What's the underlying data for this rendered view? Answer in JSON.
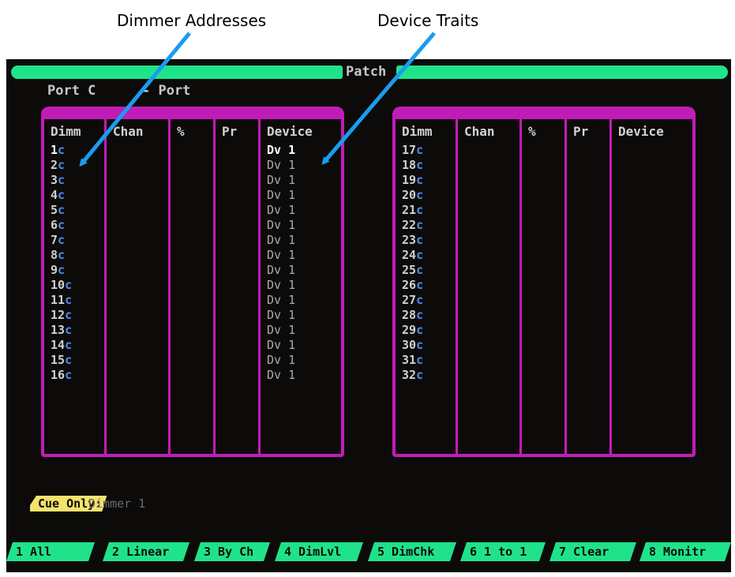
{
  "annotations": {
    "dimmer_addresses": "Dimmer Addresses",
    "device_traits": "Device Traits"
  },
  "screen": {
    "title": "Patch",
    "port_label": "Port C",
    "port_dash": "- Port",
    "columns": [
      "Dimm",
      "Chan",
      "%",
      "Pr",
      "Device"
    ],
    "left_panel": {
      "dimmers": [
        {
          "num": "1",
          "port": "c"
        },
        {
          "num": "2",
          "port": "c"
        },
        {
          "num": "3",
          "port": "c"
        },
        {
          "num": "4",
          "port": "c"
        },
        {
          "num": "5",
          "port": "c"
        },
        {
          "num": "6",
          "port": "c"
        },
        {
          "num": "7",
          "port": "c"
        },
        {
          "num": "8",
          "port": "c"
        },
        {
          "num": "9",
          "port": "c"
        },
        {
          "num": "10",
          "port": "c"
        },
        {
          "num": "11",
          "port": "c"
        },
        {
          "num": "12",
          "port": "c"
        },
        {
          "num": "13",
          "port": "c"
        },
        {
          "num": "14",
          "port": "c"
        },
        {
          "num": "15",
          "port": "c"
        },
        {
          "num": "16",
          "port": "c"
        }
      ],
      "devices": [
        "Dv 1",
        "Dv 1",
        "Dv 1",
        "Dv 1",
        "Dv 1",
        "Dv 1",
        "Dv 1",
        "Dv 1",
        "Dv 1",
        "Dv 1",
        "Dv 1",
        "Dv 1",
        "Dv 1",
        "Dv 1",
        "Dv 1",
        "Dv 1"
      ]
    },
    "right_panel": {
      "dimmers": [
        {
          "num": "17",
          "port": "c"
        },
        {
          "num": "18",
          "port": "c"
        },
        {
          "num": "19",
          "port": "c"
        },
        {
          "num": "20",
          "port": "c"
        },
        {
          "num": "21",
          "port": "c"
        },
        {
          "num": "22",
          "port": "c"
        },
        {
          "num": "23",
          "port": "c"
        },
        {
          "num": "24",
          "port": "c"
        },
        {
          "num": "25",
          "port": "c"
        },
        {
          "num": "26",
          "port": "c"
        },
        {
          "num": "27",
          "port": "c"
        },
        {
          "num": "28",
          "port": "c"
        },
        {
          "num": "29",
          "port": "c"
        },
        {
          "num": "30",
          "port": "c"
        },
        {
          "num": "31",
          "port": "c"
        },
        {
          "num": "32",
          "port": "c"
        }
      ]
    },
    "cue_label": "Cue Only:",
    "status": "Dimmer 1",
    "softkeys": [
      "1 All",
      "2 Linear",
      "3 By Ch",
      "4 DimLvl",
      "5 DimChk",
      "6 1 to 1",
      "7 Clear",
      "8 Monitr"
    ]
  },
  "colors": {
    "screen_bg": "#0d0b0a",
    "titlebar": "#1fe38a",
    "panel_border": "#c21cb8",
    "dimmer_port": "#4d8cf0",
    "cue_highlight": "#f4e36b",
    "arrow": "#1a9cf0"
  }
}
